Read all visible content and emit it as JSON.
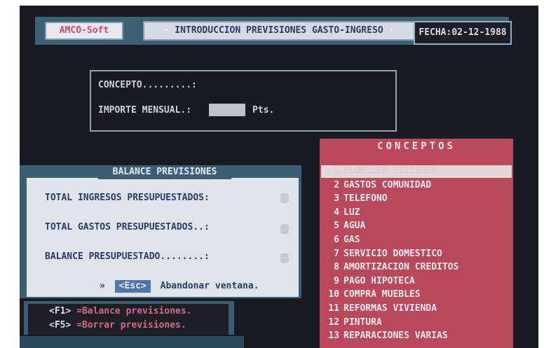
{
  "header": {
    "logo": "AMCO-Soft",
    "title": "INTRODUCCION PREVISIONES GASTO-INGRESO",
    "title_prefix": "·",
    "title_suffix": "·",
    "fecha_label": "FECHA:",
    "fecha_value": "02-12-1988"
  },
  "concept_form": {
    "concepto_label": "CONCEPTO.........:",
    "importe_label": "IMPORTE MENSUAL.:",
    "importe_value": "",
    "importe_unit": "Pts."
  },
  "balance": {
    "title": "BALANCE PREVISIONES",
    "lines": [
      {
        "label": "TOTAL INGRESOS PRESUPUESTADOS:",
        "value": ""
      },
      {
        "label": "TOTAL GASTOS PRESUPUESTADOS..:",
        "value": ""
      },
      {
        "label": "BALANCE PRESUPUESTADO........:",
        "value": ""
      }
    ],
    "esc_bullet": "»",
    "esc_key": "<Esc>",
    "esc_action": "Abandonar ventana."
  },
  "keys": [
    {
      "key": "<F1>",
      "desc": "=Balance previsiones."
    },
    {
      "key": "<F5>",
      "desc": "=Borrar previsiones."
    }
  ],
  "conceptos": {
    "title": "CONCEPTOS",
    "selected_index": 0,
    "items": [
      {
        "n": "1",
        "label": "ALQUILER VIVIENDA"
      },
      {
        "n": "2",
        "label": "GASTOS COMUNIDAD"
      },
      {
        "n": "3",
        "label": "TELEFONO"
      },
      {
        "n": "4",
        "label": "LUZ"
      },
      {
        "n": "5",
        "label": "AGUA"
      },
      {
        "n": "6",
        "label": "GAS"
      },
      {
        "n": "7",
        "label": "SERVICIO DOMESTICO"
      },
      {
        "n": "8",
        "label": "AMORTIZACION CREDITOS"
      },
      {
        "n": "9",
        "label": "PAGO HIPOTECA"
      },
      {
        "n": "10",
        "label": "COMPRA MUEBLES"
      },
      {
        "n": "11",
        "label": "REFORMAS VIVIENDA"
      },
      {
        "n": "12",
        "label": "PINTURA"
      },
      {
        "n": "13",
        "label": "REPARACIONES VARIAS"
      }
    ]
  },
  "colors": {
    "screen_bg": "#1a1a22",
    "panel_blue": "#3a5f73",
    "list_red": "#b8485a",
    "text_navy": "#2b3a6e"
  }
}
